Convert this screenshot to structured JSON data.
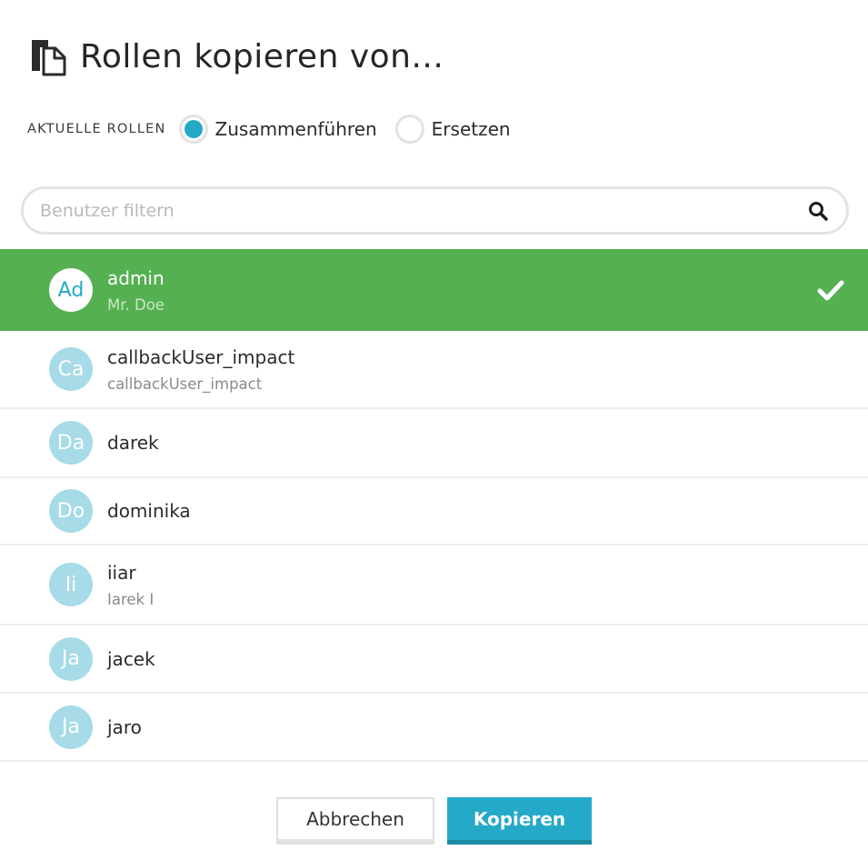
{
  "dialog": {
    "title": "Rollen kopieren von...",
    "title_icon": "copy-document-icon"
  },
  "mode": {
    "label": "AKTUELLE ROLLEN",
    "options": [
      {
        "label": "Zusammenführen",
        "selected": true
      },
      {
        "label": "Ersetzen",
        "selected": false
      }
    ]
  },
  "search": {
    "placeholder": "Benutzer filtern",
    "value": "",
    "icon": "search-icon"
  },
  "users": [
    {
      "initials": "Ad",
      "name": "admin",
      "subtitle": "Mr. Doe",
      "selected": true
    },
    {
      "initials": "Ca",
      "name": "callbackUser_impact",
      "subtitle": "callbackUser_impact",
      "selected": false
    },
    {
      "initials": "Da",
      "name": "darek",
      "subtitle": "",
      "selected": false
    },
    {
      "initials": "Do",
      "name": "dominika",
      "subtitle": "",
      "selected": false
    },
    {
      "initials": "Ii",
      "name": "iiar",
      "subtitle": "Iarek I",
      "selected": false
    },
    {
      "initials": "Ja",
      "name": "jacek",
      "subtitle": "",
      "selected": false
    },
    {
      "initials": "Ja",
      "name": "jaro",
      "subtitle": "",
      "selected": false
    }
  ],
  "buttons": {
    "cancel": "Abbrechen",
    "copy": "Kopieren"
  },
  "colors": {
    "accent": "#25a9c8",
    "selected_row": "#55b052",
    "avatar": "#a6dbe7"
  }
}
